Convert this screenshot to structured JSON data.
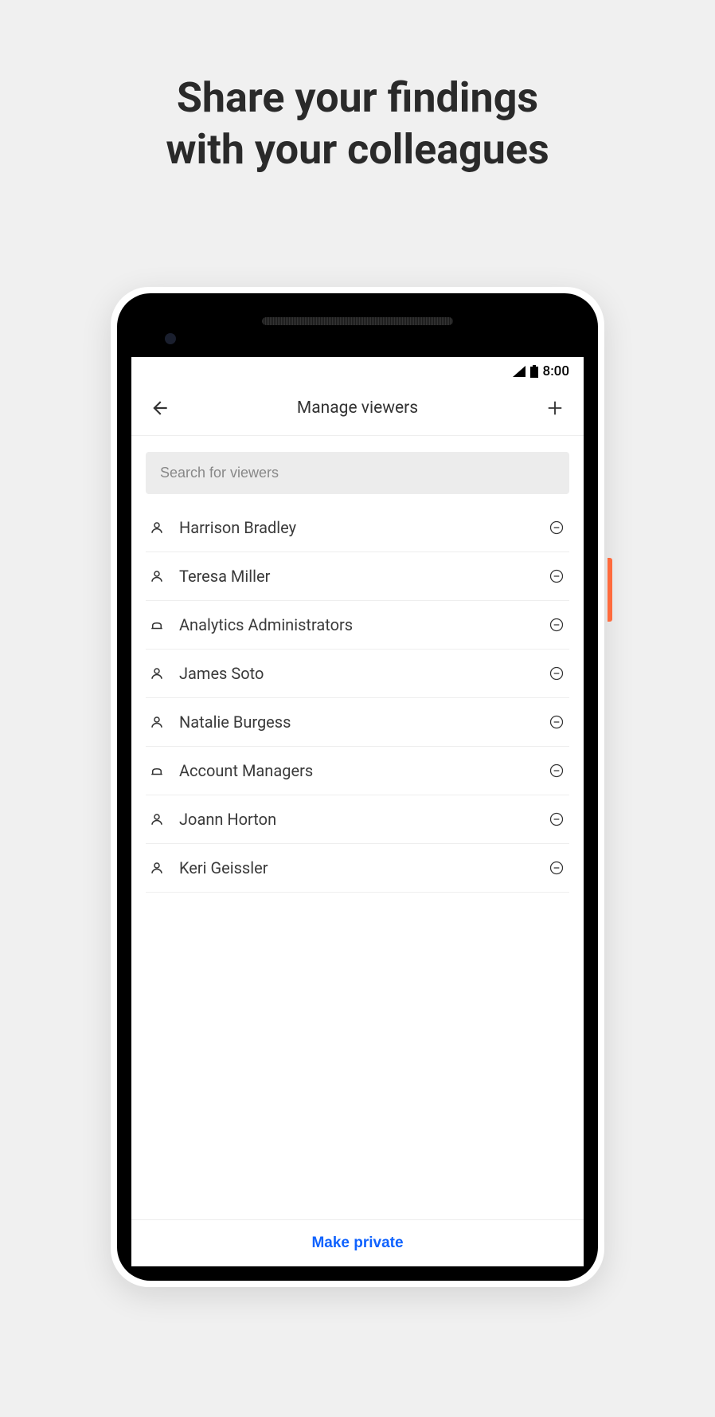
{
  "promo": {
    "line1": "Share your findings",
    "line2": "with your colleagues"
  },
  "status_bar": {
    "time": "8:00"
  },
  "header": {
    "title": "Manage viewers"
  },
  "search": {
    "placeholder": "Search for viewers"
  },
  "viewers": [
    {
      "name": "Harrison Bradley",
      "type": "person"
    },
    {
      "name": "Teresa Miller",
      "type": "person"
    },
    {
      "name": "Analytics Administrators",
      "type": "group"
    },
    {
      "name": "James Soto",
      "type": "person"
    },
    {
      "name": "Natalie Burgess",
      "type": "person"
    },
    {
      "name": "Account Managers",
      "type": "group"
    },
    {
      "name": "Joann Horton",
      "type": "person"
    },
    {
      "name": "Keri Geissler",
      "type": "person"
    }
  ],
  "footer": {
    "make_private_label": "Make private"
  }
}
